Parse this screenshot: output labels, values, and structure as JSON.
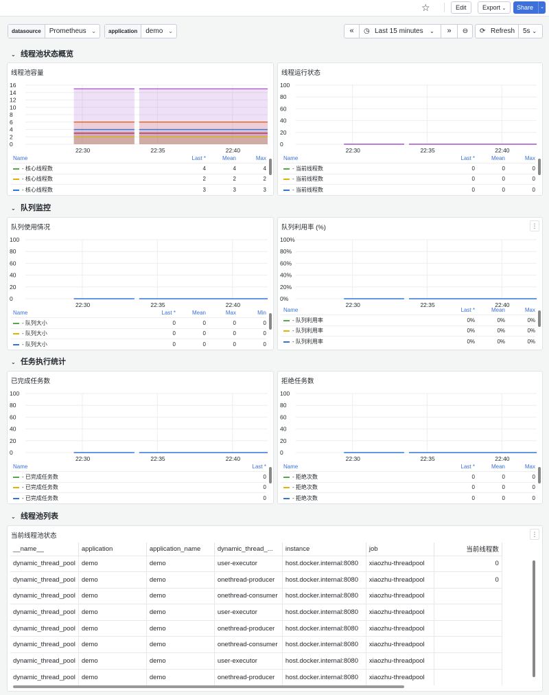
{
  "toolbar": {
    "edit": "Edit",
    "export": "Export",
    "share": "Share"
  },
  "variables": [
    {
      "label": "datasource",
      "value": "Prometheus"
    },
    {
      "label": "application",
      "value": "demo"
    }
  ],
  "timepicker": {
    "range": "Last 15 minutes",
    "refresh": "Refresh",
    "interval": "5s"
  },
  "rows": [
    "线程池状态概览",
    "队列监控",
    "任务执行统计",
    "线程池列表"
  ],
  "colors": {
    "green": "#56a64b",
    "yellow": "#e0b400",
    "blue": "#3274d9",
    "purple": "#a352cc",
    "orange": "#e55400"
  },
  "x_ticks": [
    "22:30",
    "22:35",
    "22:40"
  ],
  "panels": [
    {
      "title": "线程池容量",
      "yticks": [
        "16",
        "14",
        "12",
        "10",
        "8",
        "6",
        "4",
        "2",
        "0"
      ],
      "legend_cols": [
        "Name",
        "Last *",
        "Mean",
        "Max"
      ],
      "legend_rows": [
        {
          "name": "- 核心线程数",
          "vals": [
            "4",
            "4",
            "4"
          ]
        },
        {
          "name": "- 核心线程数",
          "vals": [
            "2",
            "2",
            "2"
          ]
        },
        {
          "name": "- 核心线程数",
          "vals": [
            "3",
            "3",
            "3"
          ]
        }
      ]
    },
    {
      "title": "线程运行状态",
      "yticks": [
        "100",
        "80",
        "60",
        "40",
        "20",
        "0"
      ],
      "legend_cols": [
        "Name",
        "Last *",
        "Mean",
        "Max"
      ],
      "legend_rows": [
        {
          "name": "- 当前线程数",
          "vals": [
            "0",
            "0",
            "0"
          ]
        },
        {
          "name": "- 当前线程数",
          "vals": [
            "0",
            "0",
            "0"
          ]
        },
        {
          "name": "- 当前线程数",
          "vals": [
            "0",
            "0",
            "0"
          ]
        }
      ]
    },
    {
      "title": "队列使用情况",
      "yticks": [
        "100",
        "80",
        "60",
        "40",
        "20",
        "0"
      ],
      "legend_cols": [
        "Name",
        "Last *",
        "Mean",
        "Max",
        "Min"
      ],
      "legend_rows": [
        {
          "name": "- 队列大小",
          "vals": [
            "0",
            "0",
            "0",
            "0"
          ]
        },
        {
          "name": "- 队列大小",
          "vals": [
            "0",
            "0",
            "0",
            "0"
          ]
        },
        {
          "name": "- 队列大小",
          "vals": [
            "0",
            "0",
            "0",
            "0"
          ]
        }
      ]
    },
    {
      "title": "队列利用率 (%)",
      "yticks": [
        "100%",
        "80%",
        "60%",
        "40%",
        "20%",
        "0%"
      ],
      "legend_cols": [
        "Name",
        "Last *",
        "Mean",
        "Max"
      ],
      "legend_rows": [
        {
          "name": "- 队列利用率",
          "vals": [
            "0%",
            "0%",
            "0%"
          ]
        },
        {
          "name": "- 队列利用率",
          "vals": [
            "0%",
            "0%",
            "0%"
          ]
        },
        {
          "name": "- 队列利用率",
          "vals": [
            "0%",
            "0%",
            "0%"
          ]
        }
      ]
    },
    {
      "title": "已完成任务数",
      "yticks": [
        "100",
        "80",
        "60",
        "40",
        "20",
        "0"
      ],
      "legend_cols": [
        "Name",
        "Last *"
      ],
      "legend_rows": [
        {
          "name": "- 已完成任务数",
          "vals": [
            "0"
          ]
        },
        {
          "name": "- 已完成任务数",
          "vals": [
            "0"
          ]
        },
        {
          "name": "- 已完成任务数",
          "vals": [
            "0"
          ]
        }
      ]
    },
    {
      "title": "拒绝任务数",
      "yticks": [
        "100",
        "80",
        "60",
        "40",
        "20",
        "0"
      ],
      "legend_cols": [
        "Name",
        "Last *",
        "Mean",
        "Max"
      ],
      "legend_rows": [
        {
          "name": "- 拒绝次数",
          "vals": [
            "0",
            "0",
            "0"
          ]
        },
        {
          "name": "- 拒绝次数",
          "vals": [
            "0",
            "0",
            "0"
          ]
        },
        {
          "name": "- 拒绝次数",
          "vals": [
            "0",
            "0",
            "0"
          ]
        }
      ]
    }
  ],
  "chart_data": [
    {
      "type": "area",
      "title": "线程池容量",
      "x": [
        "22:28",
        "22:33",
        "22:34",
        "22:43"
      ],
      "ylim": [
        0,
        16
      ],
      "series": [
        {
          "name": "- 核心线程数",
          "values": [
            15,
            15,
            15,
            15
          ]
        },
        {
          "name": "- 核心线程数",
          "values": [
            6,
            6,
            6,
            6
          ]
        },
        {
          "name": "- 核心线程数",
          "values": [
            4,
            4,
            4,
            4
          ]
        },
        {
          "name": "- 核心线程数",
          "values": [
            3,
            3,
            3,
            3
          ]
        },
        {
          "name": "- 核心线程数",
          "values": [
            2,
            2,
            2,
            2
          ]
        }
      ]
    },
    {
      "type": "line",
      "title": "线程运行状态",
      "ylim": [
        0,
        100
      ],
      "series": [
        {
          "name": "- 当前线程数",
          "values": [
            0,
            0
          ]
        }
      ]
    },
    {
      "type": "line",
      "title": "队列使用情况",
      "ylim": [
        0,
        100
      ],
      "series": [
        {
          "name": "- 队列大小",
          "values": [
            0,
            0
          ]
        }
      ]
    },
    {
      "type": "line",
      "title": "队列利用率 (%)",
      "ylim": [
        0,
        100
      ],
      "series": [
        {
          "name": "- 队列利用率",
          "values": [
            0,
            0
          ]
        }
      ]
    },
    {
      "type": "line",
      "title": "已完成任务数",
      "ylim": [
        0,
        100
      ],
      "series": [
        {
          "name": "- 已完成任务数",
          "values": [
            0,
            0
          ]
        }
      ]
    },
    {
      "type": "line",
      "title": "拒绝任务数",
      "ylim": [
        0,
        100
      ],
      "series": [
        {
          "name": "- 拒绝次数",
          "values": [
            0,
            0
          ]
        }
      ]
    }
  ],
  "table": {
    "title": "当前线程池状态",
    "columns": [
      "__name__",
      "application",
      "application_name",
      "dynamic_thread_...",
      "instance",
      "job",
      "当前线程数"
    ],
    "rows": [
      [
        "dynamic_thread_pool",
        "demo",
        "demo",
        "user-executor",
        "host.docker.internal:8080",
        "xiaozhu-threadpool",
        "0"
      ],
      [
        "dynamic_thread_pool",
        "demo",
        "demo",
        "onethread-producer",
        "host.docker.internal:8080",
        "xiaozhu-threadpool",
        "0"
      ],
      [
        "dynamic_thread_pool",
        "demo",
        "demo",
        "onethread-consumer",
        "host.docker.internal:8080",
        "xiaozhu-threadpool",
        ""
      ],
      [
        "dynamic_thread_pool",
        "demo",
        "demo",
        "user-executor",
        "host.docker.internal:8080",
        "xiaozhu-threadpool",
        ""
      ],
      [
        "dynamic_thread_pool",
        "demo",
        "demo",
        "onethread-producer",
        "host.docker.internal:8080",
        "xiaozhu-threadpool",
        ""
      ],
      [
        "dynamic_thread_pool",
        "demo",
        "demo",
        "onethread-consumer",
        "host.docker.internal:8080",
        "xiaozhu-threadpool",
        ""
      ],
      [
        "dynamic_thread_pool",
        "demo",
        "demo",
        "user-executor",
        "host.docker.internal:8080",
        "xiaozhu-threadpool",
        ""
      ],
      [
        "dynamic_thread_pool",
        "demo",
        "demo",
        "onethread-producer",
        "host.docker.internal:8080",
        "xiaozhu-threadpool",
        ""
      ]
    ]
  }
}
